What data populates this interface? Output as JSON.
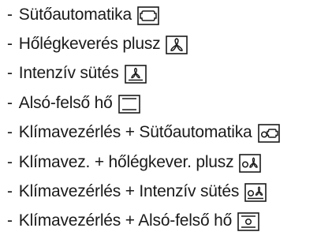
{
  "bullet": "-",
  "colors": {
    "text": "#1a1a1a",
    "icon_stroke": "#1a1a1a",
    "background": "#ffffff"
  },
  "modes": [
    {
      "label": "Sütőautomatika",
      "icon": "auto-bake-icon"
    },
    {
      "label": "Hőlégkeverés plusz",
      "icon": "hot-air-plus-fan-icon"
    },
    {
      "label": "Intenzív sütés",
      "icon": "intensive-bake-icon"
    },
    {
      "label": "Alsó-felső hő",
      "icon": "top-bottom-heat-icon"
    },
    {
      "label": "Klímavezérlés + Sütőautomatika",
      "icon": "climate-auto-bake-icon"
    },
    {
      "label": "Klímavez. + hőlégkever. plusz",
      "icon": "climate-hot-air-plus-icon"
    },
    {
      "label": "Klímavezérlés + Intenzív sütés",
      "icon": "climate-intensive-bake-icon"
    },
    {
      "label": "Klímavezérlés + Alsó-felső hő",
      "icon": "climate-top-bottom-heat-icon"
    }
  ]
}
